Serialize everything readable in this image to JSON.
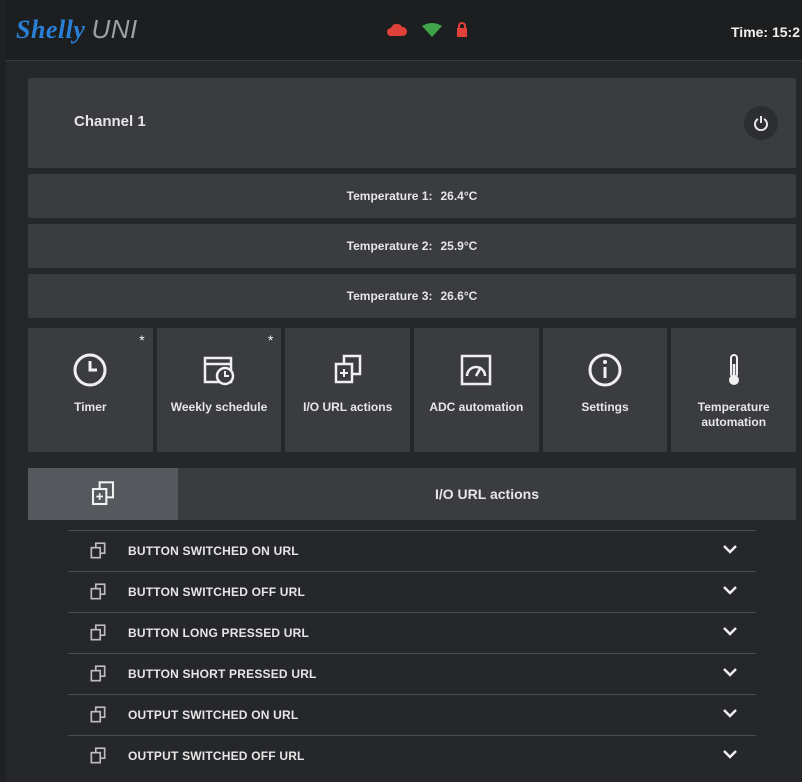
{
  "header": {
    "brand": "Shelly",
    "model": "UNI",
    "time": "Time: 15:2",
    "icons": [
      "cloud-icon",
      "wifi-icon",
      "lock-icon"
    ],
    "colors": {
      "cloud": "#e0413b",
      "wifi": "#3fa44a",
      "lock": "#e0413b",
      "brand": "#2a7fd6"
    }
  },
  "channel": {
    "title": "Channel 1"
  },
  "temperatures": [
    {
      "label": "Temperature 1:",
      "value": "26.4°C"
    },
    {
      "label": "Temperature 2:",
      "value": "25.9°C"
    },
    {
      "label": "Temperature 3:",
      "value": "26.6°C"
    }
  ],
  "tiles": [
    {
      "label": "Timer",
      "icon": "clock-icon",
      "star": "*"
    },
    {
      "label": "Weekly schedule",
      "icon": "calendar-icon",
      "star": "*"
    },
    {
      "label": "I/O URL actions",
      "icon": "io-url-icon",
      "star": ""
    },
    {
      "label": "ADC automation",
      "icon": "adc-icon",
      "star": ""
    },
    {
      "label": "Settings",
      "icon": "info-icon",
      "star": ""
    },
    {
      "label": "Temperature automation",
      "icon": "thermometer-icon",
      "star": ""
    }
  ],
  "section": {
    "title": "I/O URL actions"
  },
  "url_actions": [
    "BUTTON SWITCHED ON URL",
    "BUTTON SWITCHED OFF URL",
    "BUTTON LONG PRESSED URL",
    "BUTTON SHORT PRESSED URL",
    "OUTPUT SWITCHED ON URL",
    "OUTPUT SWITCHED OFF URL"
  ]
}
